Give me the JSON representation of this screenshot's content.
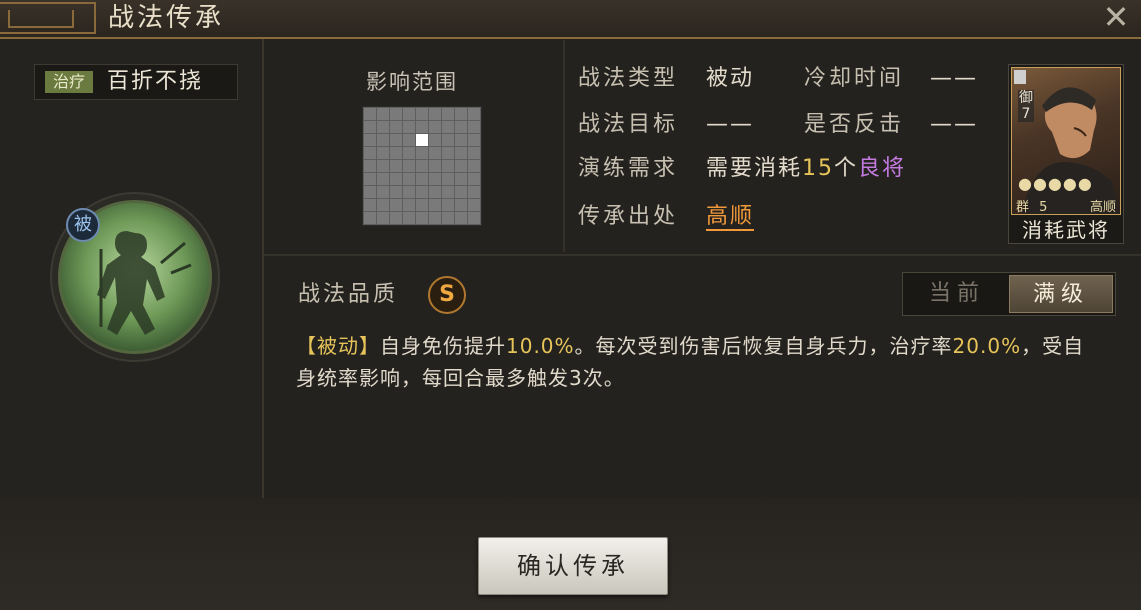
{
  "window": {
    "title": "战法传承"
  },
  "skill": {
    "type_tag": "治疗",
    "name": "百折不挠",
    "passive_badge": "被"
  },
  "range": {
    "label": "影响范围",
    "grid_size": 9,
    "active_cell": [
      4,
      2
    ]
  },
  "info": {
    "type_label": "战法类型",
    "type_value": "被动",
    "cooldown_label": "冷却时间",
    "cooldown_value": "——",
    "target_label": "战法目标",
    "target_value": "——",
    "counter_label": "是否反击",
    "counter_value": "——",
    "requirement_label": "演练需求",
    "requirement_prefix": "需要消耗",
    "requirement_count": "15",
    "requirement_unit": "个",
    "requirement_quality": "良将",
    "origin_label": "传承出处",
    "origin_value": "高顺"
  },
  "hero_card": {
    "troop": "御",
    "cost": "7",
    "stars": "●●●●●",
    "faction": "群",
    "level": "5",
    "name": "高顺",
    "caption": "消耗武将"
  },
  "quality": {
    "label": "战法品质",
    "grade": "S"
  },
  "toggle": {
    "current_label": "当前",
    "max_label": "满级"
  },
  "description": {
    "tag": "【被动】",
    "text1": "自身免伤提升",
    "num1": "10.0%",
    "text2": "。每次受到伤害后恢复自身兵力，治疗率",
    "num2": "20.0%",
    "text3": "，受自身统率影响，每回合最多触发3次。"
  },
  "confirm_button": "确认传承"
}
